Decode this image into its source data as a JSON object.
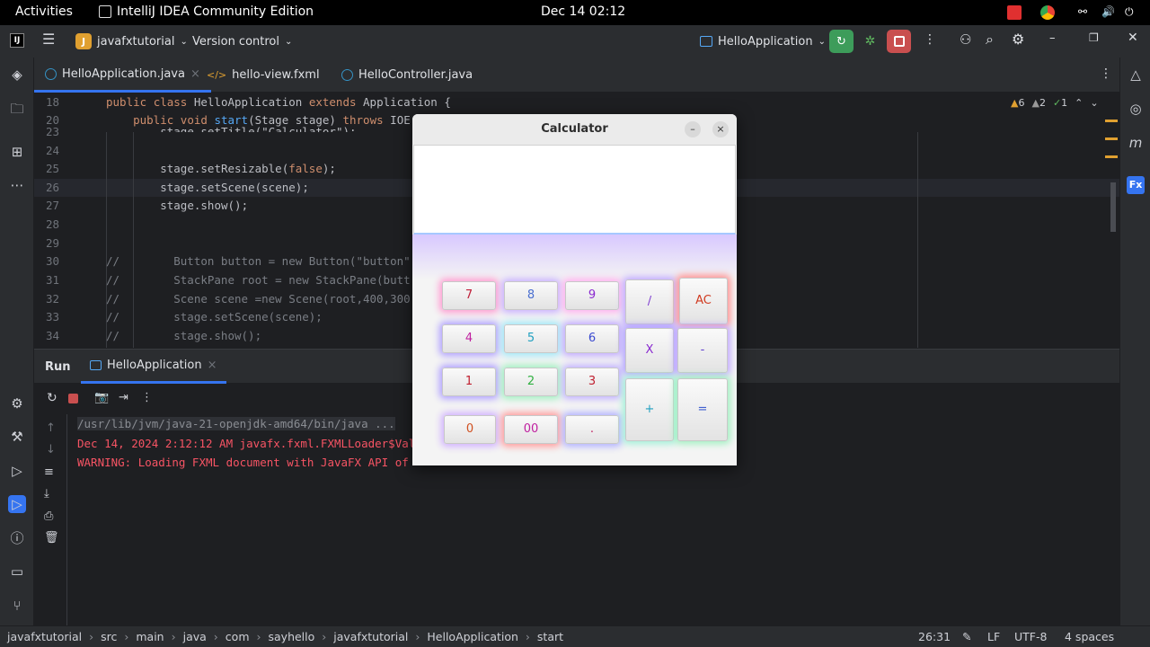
{
  "os_bar": {
    "activities": "Activities",
    "app_name": "IntelliJ IDEA Community Edition",
    "clock": "Dec 14  02:12"
  },
  "header": {
    "project_badge": "J",
    "project": "javafxtutorial",
    "vcs": "Version control",
    "run_config": "HelloApplication"
  },
  "tabs": [
    {
      "label": "HelloApplication.java",
      "close": "×"
    },
    {
      "label": "hello-view.fxml"
    },
    {
      "label": "HelloController.java"
    }
  ],
  "inspections": {
    "warnings": "6",
    "weak": "2",
    "ok": "1"
  },
  "editor": {
    "lines": [
      {
        "n": "18",
        "code": "public class HelloApplication extends Application {"
      },
      {
        "n": "20",
        "code": "    public void start(Stage stage) throws IOE"
      },
      {
        "n": "23",
        "code": "        stage.setTitle(\"Calculator\");"
      },
      {
        "n": "24",
        "code": ""
      },
      {
        "n": "25",
        "code": "        stage.setResizable(false);"
      },
      {
        "n": "26",
        "code": "        stage.setScene(scene);"
      },
      {
        "n": "27",
        "code": "        stage.show();"
      },
      {
        "n": "28",
        "code": ""
      },
      {
        "n": "29",
        "code": ""
      },
      {
        "n": "30",
        "code": "//        Button button = new Button(\"button\""
      },
      {
        "n": "31",
        "code": "//        StackPane root = new StackPane(butt"
      },
      {
        "n": "32",
        "code": "//        Scene scene =new Scene(root,400,300"
      },
      {
        "n": "33",
        "code": "//        stage.setScene(scene);"
      },
      {
        "n": "34",
        "code": "//        stage.show();"
      }
    ]
  },
  "run": {
    "label": "Run",
    "tab": "HelloApplication",
    "close": "×",
    "console": [
      "/usr/lib/jvm/java-21-openjdk-amd64/bin/java ...",
      "Dec 14, 2024 2:12:12 AM javafx.fxml.FXMLLoader$Val",
      "WARNING: Loading FXML document with JavaFX API of"
    ]
  },
  "calculator": {
    "title": "Calculator",
    "minimize": "–",
    "close": "×",
    "buttons": [
      {
        "label": "7",
        "color": "#c0203a"
      },
      {
        "label": "8",
        "color": "#4a6fd0"
      },
      {
        "label": "9",
        "color": "#8a2ad0"
      },
      {
        "label": "4",
        "color": "#c020a0"
      },
      {
        "label": "5",
        "color": "#20a0c0"
      },
      {
        "label": "6",
        "color": "#3a4ad0"
      },
      {
        "label": "1",
        "color": "#c02030"
      },
      {
        "label": "2",
        "color": "#30b040"
      },
      {
        "label": "3",
        "color": "#c02030"
      },
      {
        "label": "0",
        "color": "#d05020"
      },
      {
        "label": "00",
        "color": "#c020a0"
      },
      {
        "label": ".",
        "color": "#c02060"
      },
      {
        "label": "/",
        "color": "#8040d0"
      },
      {
        "label": "AC",
        "color": "#d03a20"
      },
      {
        "label": "X",
        "color": "#8a2ad0"
      },
      {
        "label": "-",
        "color": "#6040d0"
      },
      {
        "label": "+",
        "color": "#20a0c0"
      },
      {
        "label": "=",
        "color": "#4060d0"
      }
    ]
  },
  "status": {
    "crumbs": [
      "javafxtutorial",
      "src",
      "main",
      "java",
      "com",
      "sayhello",
      "javafxtutorial",
      "HelloApplication",
      "start"
    ],
    "position": "26:31",
    "line_sep": "LF",
    "encoding": "UTF-8",
    "indent": "4 spaces"
  }
}
